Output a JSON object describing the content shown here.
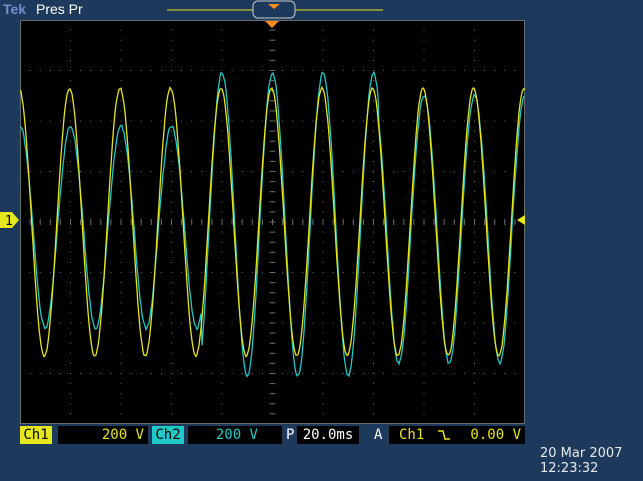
{
  "header": {
    "brand": "Tek",
    "acquisition_state": "Pres Pr"
  },
  "colors": {
    "ch1": "#e6e61e",
    "ch2": "#20c8c8",
    "trigger_marker": "#ff8a1e",
    "graticule": "#6a6a6a"
  },
  "markers": {
    "ch1_ground": "1"
  },
  "readouts": {
    "ch1_label": "Ch1",
    "ch1_scale": "200 V",
    "ch2_label": "Ch2",
    "ch2_scale": "200 V",
    "time_prefix": "P",
    "timebase": "20.0ms",
    "trigger_mode": "A",
    "trigger_source": "Ch1",
    "trigger_slope_icon": "falling-edge-icon",
    "trigger_level": "0.00 V"
  },
  "datetime": {
    "date": "20 Mar 2007",
    "time": "12:23:32"
  },
  "waveforms": {
    "time_per_div_ms": 20,
    "volts_per_div": 200,
    "ch1": {
      "frequency_hz": 50,
      "amplitude_v": 530,
      "phase_deg": 97
    },
    "ch2": {
      "frequency_hz": 50,
      "phase_deg": 90,
      "segments": [
        {
          "until_ms": 72,
          "positive_peak_v": 380,
          "negative_peak_v": -420
        },
        {
          "until_ms": 142,
          "positive_peak_v": 590,
          "negative_peak_v": -610
        },
        {
          "until_ms": 200,
          "positive_peak_v": 500,
          "negative_peak_v": -560
        }
      ]
    }
  }
}
